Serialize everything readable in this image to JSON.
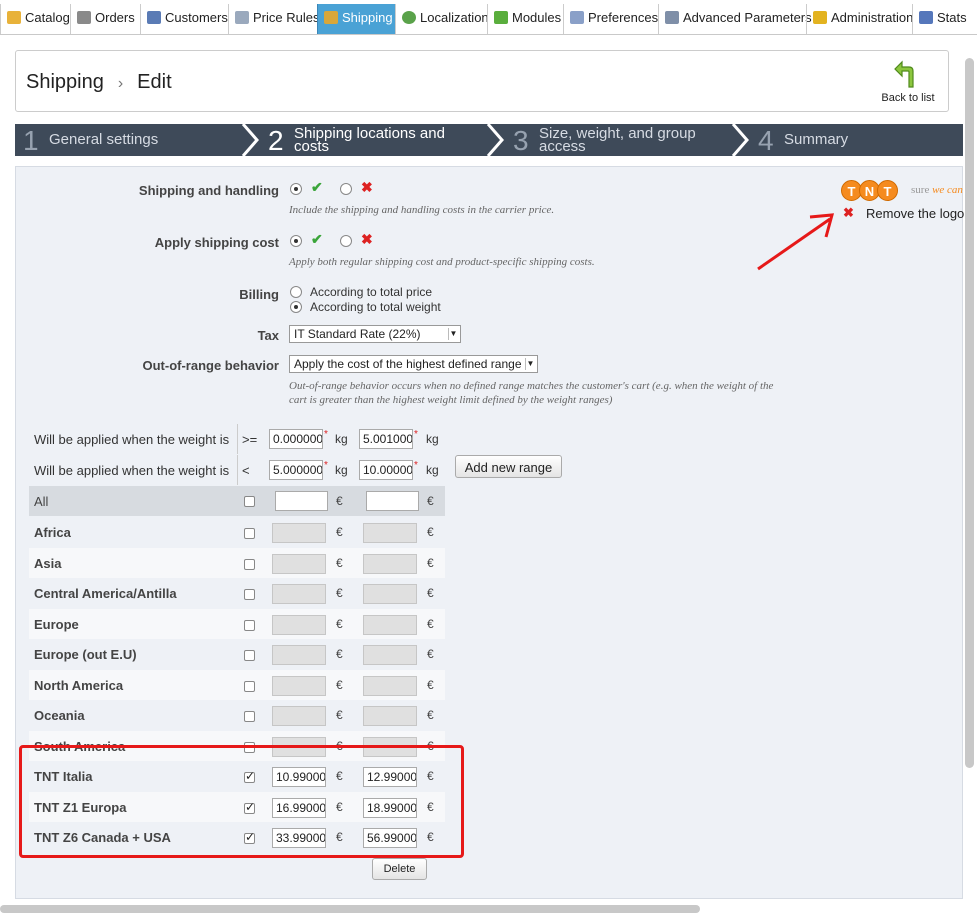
{
  "nav": {
    "tabs": [
      {
        "label": "Catalog",
        "icon": "folder-icon",
        "color": "#e8b23a"
      },
      {
        "label": "Orders",
        "icon": "cart-icon",
        "color": "#8a8a8a"
      },
      {
        "label": "Customers",
        "icon": "customer-icon",
        "color": "#5a7bb5"
      },
      {
        "label": "Price Rules",
        "icon": "price-icon",
        "color": "#9aa9bd"
      },
      {
        "label": "Shipping",
        "icon": "truck-icon",
        "color": "#d9a73a"
      },
      {
        "label": "Localization",
        "icon": "globe-icon",
        "color": "#5aa24a"
      },
      {
        "label": "Modules",
        "icon": "puzzle-icon",
        "color": "#5aae3d"
      },
      {
        "label": "Preferences",
        "icon": "preferences-icon",
        "color": "#8aa0c8"
      },
      {
        "label": "Advanced Parameters",
        "icon": "wrench-icon",
        "color": "#7f8fa8"
      },
      {
        "label": "Administration",
        "icon": "key-icon",
        "color": "#e3b320"
      },
      {
        "label": "Stats",
        "icon": "stats-icon",
        "color": "#5577bb"
      }
    ],
    "active_tab": "Shipping"
  },
  "header": {
    "section": "Shipping",
    "page": "Edit",
    "back_label": "Back to list"
  },
  "steps": [
    {
      "num": "1",
      "label": "General settings"
    },
    {
      "num": "2",
      "label": "Shipping locations and costs"
    },
    {
      "num": "3",
      "label": "Size, weight, and group access"
    },
    {
      "num": "4",
      "label": "Summary"
    }
  ],
  "form": {
    "shipping_handling": {
      "label": "Shipping and handling",
      "help": "Include the shipping and handling costs in the carrier price.",
      "value": "yes"
    },
    "apply_cost": {
      "label": "Apply shipping cost",
      "help": "Apply both regular shipping cost and product-specific shipping costs.",
      "value": "yes"
    },
    "billing": {
      "label": "Billing",
      "options": [
        "According to total price",
        "According to total weight"
      ],
      "selected": "According to total weight"
    },
    "tax": {
      "label": "Tax",
      "value": "IT Standard Rate (22%)"
    },
    "out_of_range": {
      "label": "Out-of-range behavior",
      "value": "Apply the cost of the highest defined range",
      "help": "Out-of-range behavior occurs when no defined range matches the customer's cart (e.g. when the weight of the cart is greater than the highest weight limit defined by the weight ranges)"
    }
  },
  "logo": {
    "brand": "TNT",
    "tagline": "sure we can",
    "remove_label": "Remove the logo"
  },
  "ranges": {
    "row_label": "Will be applied when the weight is",
    "ge": ">=",
    "lt": "<",
    "unit": "kg",
    "inf": [
      "0.000000",
      "5.001000"
    ],
    "sup": [
      "5.000000",
      "10.000000"
    ],
    "add_label": "Add new range"
  },
  "zones": {
    "all_label": "All",
    "currency": "€",
    "rows": [
      {
        "name": "Africa",
        "checked": false,
        "v1": "",
        "v2": ""
      },
      {
        "name": "Asia",
        "checked": false,
        "v1": "",
        "v2": ""
      },
      {
        "name": "Central America/Antilla",
        "checked": false,
        "v1": "",
        "v2": ""
      },
      {
        "name": "Europe",
        "checked": false,
        "v1": "",
        "v2": ""
      },
      {
        "name": "Europe (out E.U)",
        "checked": false,
        "v1": "",
        "v2": ""
      },
      {
        "name": "North America",
        "checked": false,
        "v1": "",
        "v2": ""
      },
      {
        "name": "Oceania",
        "checked": false,
        "v1": "",
        "v2": ""
      },
      {
        "name": "South America",
        "checked": false,
        "v1": "",
        "v2": ""
      },
      {
        "name": "TNT Italia",
        "checked": true,
        "v1": "10.990000",
        "v2": "12.990000"
      },
      {
        "name": "TNT Z1 Europa",
        "checked": true,
        "v1": "16.990000",
        "v2": "18.990000"
      },
      {
        "name": "TNT Z6 Canada + USA",
        "checked": true,
        "v1": "33.990000",
        "v2": "56.990000"
      }
    ],
    "delete_label": "Delete"
  }
}
